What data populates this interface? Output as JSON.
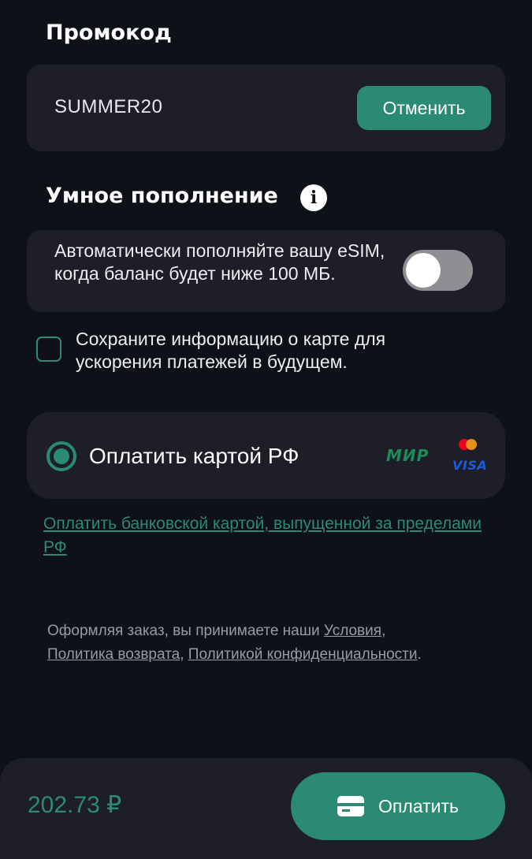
{
  "promo": {
    "title": "Промокод",
    "code": "SUMMER20",
    "cancel_label": "Отменить"
  },
  "smart_topup": {
    "title": "Умное пополнение",
    "description": "Автоматически пополняйте вашу eSIM, когда баланс будет ниже 100 МБ.",
    "enabled": false
  },
  "save_card": {
    "label": "Сохраните информацию о карте для ускорения платежей в будущем.",
    "checked": false
  },
  "payment": {
    "option_label": "Оплатить картой РФ",
    "mir_logo": "МИР",
    "visa_logo": "VISA",
    "foreign_card_link": "Оплатить банковской картой, выпущенной за пределами РФ"
  },
  "terms": {
    "prefix": "Оформляя заказ, вы принимаете наши ",
    "conditions": "Условия",
    "sep1": ",",
    "refund": "Политика возврата",
    "sep2": ", ",
    "privacy": "Политикой конфиденциальности",
    "end": "."
  },
  "checkout": {
    "total": "202.73 ₽",
    "pay_label": "Оплатить"
  },
  "colors": {
    "accent": "#2b8a74",
    "card_bg": "#1d1e27",
    "page_bg": "#0f1118"
  }
}
